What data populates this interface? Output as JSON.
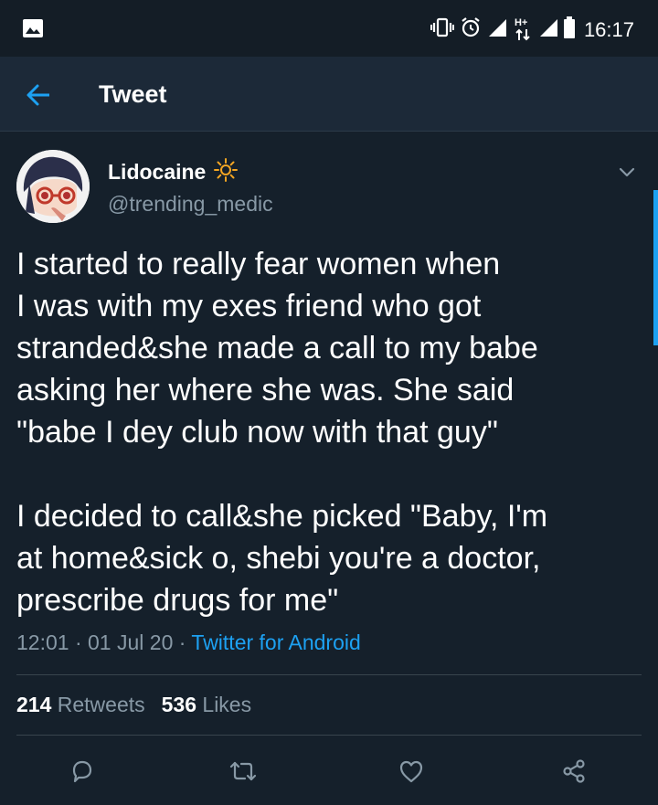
{
  "status_bar": {
    "time": "16:17",
    "network_label": "H+",
    "icons": [
      "image-icon",
      "vibrate-icon",
      "alarm-icon",
      "signal-icon",
      "data-arrows-icon",
      "signal-icon",
      "battery-icon"
    ]
  },
  "app_bar": {
    "title": "Tweet",
    "back_icon": "arrow-left-icon"
  },
  "tweet": {
    "author": {
      "display_name": "Lidocaine",
      "name_emoji": "sun-icon",
      "handle": "@trending_medic"
    },
    "text": "I started to really fear women when\nI was with my exes friend who got\nstranded&she made a call to my babe\nasking her where she was. She said\n\"babe I dey club now with that guy\"\n\nI decided to call&she picked \"Baby, I'm\nat home&sick o, shebi you're a doctor,\nprescribe drugs for me\"",
    "time": "12:01",
    "date": "01 Jul 20",
    "separator": "·",
    "source": "Twitter for Android",
    "retweets_count": "214",
    "retweets_label": "Retweets",
    "likes_count": "536",
    "likes_label": "Likes"
  },
  "actions": [
    "reply-icon",
    "retweet-icon",
    "like-icon",
    "share-icon"
  ],
  "colors": {
    "background": "#15202b",
    "app_bar": "#1c2938",
    "accent": "#1da1f2",
    "secondary_text": "#8899a6",
    "divider": "#38444d"
  }
}
